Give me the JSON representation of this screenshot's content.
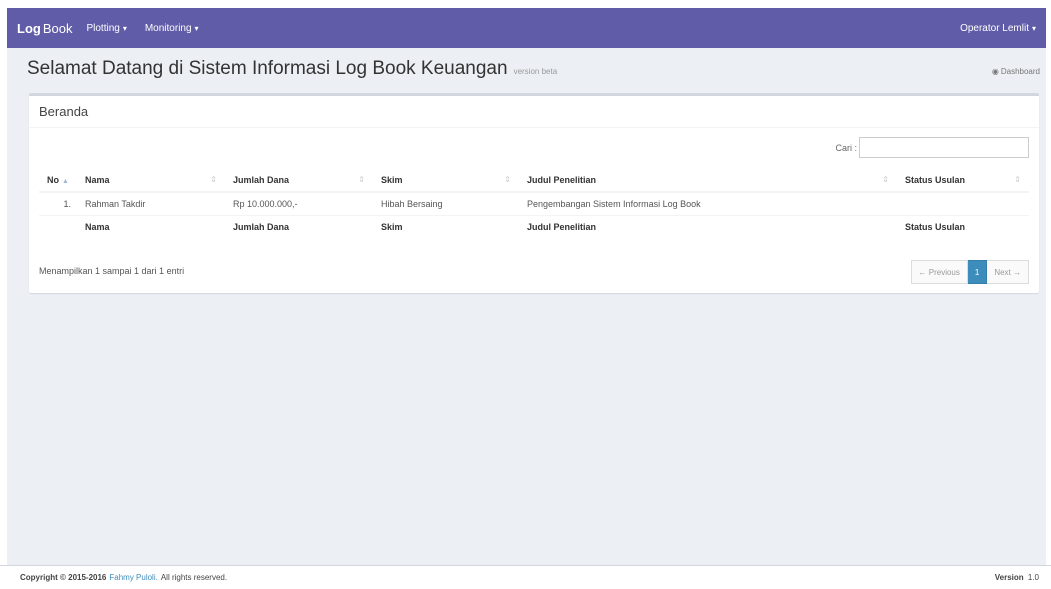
{
  "navbar": {
    "brand_bold": "Log",
    "brand_rest": "Book",
    "menu": [
      {
        "label": "Plotting"
      },
      {
        "label": "Monitoring"
      }
    ],
    "user": "Operator Lemlit",
    "color": "#605ca8"
  },
  "header": {
    "title": "Selamat Datang di Sistem Informasi Log Book Keuangan",
    "subtitle": "version beta",
    "breadcrumb": "Dashboard",
    "breadcrumb_icon": "dashboard-icon"
  },
  "box": {
    "title": "Beranda",
    "search_label": "Cari :",
    "search_value": "",
    "columns": [
      "No",
      "Nama",
      "Jumlah Dana",
      "Skim",
      "Judul Penelitian",
      "Status Usulan"
    ],
    "rows": [
      {
        "no": "1.",
        "nama": "Rahman Takdir",
        "jumlah_dana": "Rp 10.000.000,-",
        "skim": "Hibah Bersaing",
        "judul": "Pengembangan Sistem Informasi Log Book",
        "status": ""
      }
    ],
    "footer_columns": [
      "",
      "Nama",
      "Jumlah Dana",
      "Skim",
      "Judul Penelitian",
      "Status Usulan"
    ],
    "info": "Menampilkan 1 sampai 1 dari 1 entri",
    "pagination": {
      "previous": "← Previous",
      "current": "1",
      "next": "Next →"
    }
  },
  "footer": {
    "copyright": "Copyright © 2015-2016",
    "author": "Fahmy Puloli.",
    "rights": "All rights reserved.",
    "version_label": "Version",
    "version_value": "1.0"
  },
  "colors": {
    "accent": "#3c8dbc",
    "background": "#ecf0f5"
  }
}
